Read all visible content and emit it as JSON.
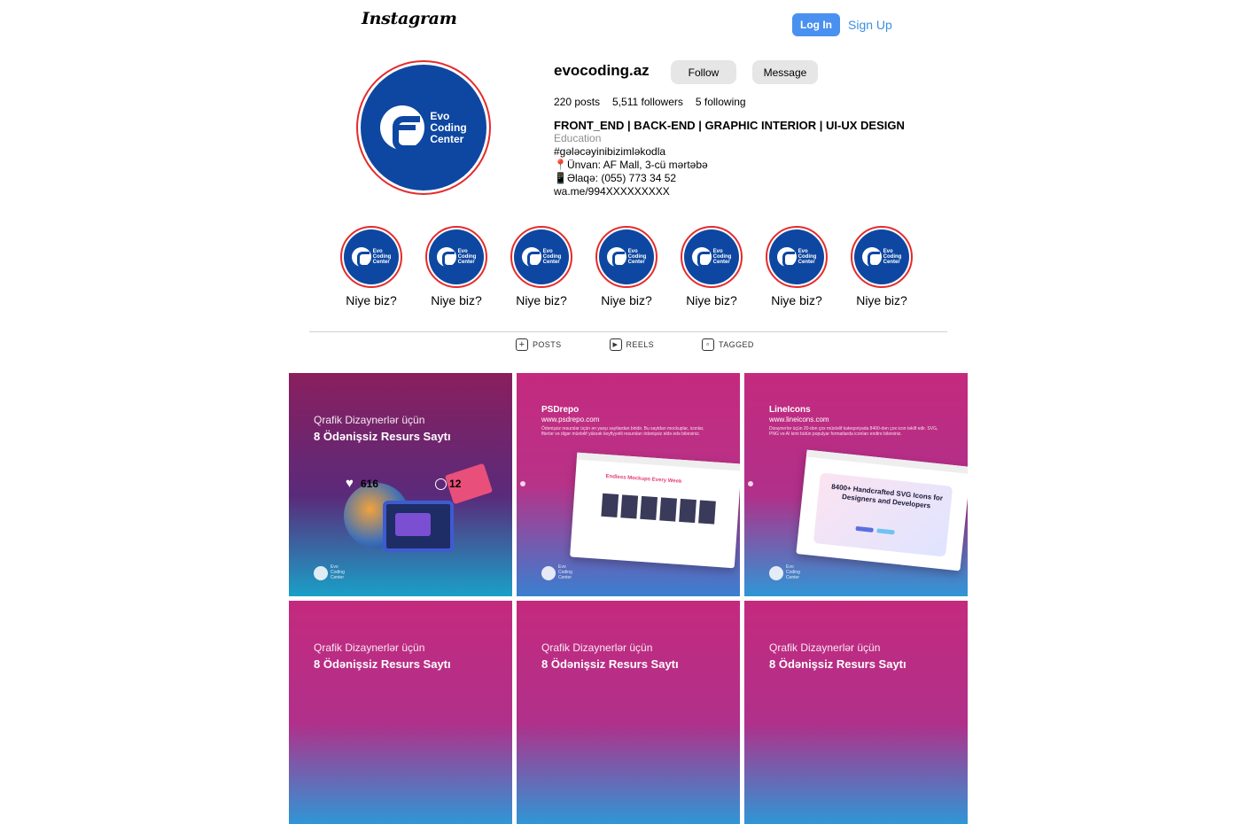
{
  "header": {
    "logo": "Instagram",
    "login_label": "Log In",
    "signup_label": "Sign Up"
  },
  "profile": {
    "username": "evocoding.az",
    "follow_label": "Follow",
    "message_label": "Message",
    "avatar_text": "Evo\nCoding\nCenter",
    "stats": {
      "posts": "220 posts",
      "followers": "5,511 followers",
      "following": "5 following"
    },
    "bio": {
      "name": "FRONT_END | BACK-END | GRAPHIC INTERIOR | UI-UX DESIGN",
      "category": "Education",
      "line1": "#gələcəyinibizimləkodla",
      "line2": "📍Ünvan: AF Mall, 3-cü mərtəbə",
      "line3": "📱Əlaqə: (055) 773 34 52",
      "line4": "wa.me/994XXXXXXXXX"
    }
  },
  "highlights": [
    {
      "label": "Niye biz?"
    },
    {
      "label": "Niye biz?"
    },
    {
      "label": "Niye biz?"
    },
    {
      "label": "Niye biz?"
    },
    {
      "label": "Niye biz?"
    },
    {
      "label": "Niye biz?"
    },
    {
      "label": "Niye biz?"
    }
  ],
  "highlight_brand": "Evo\nCoding\nCenter",
  "tabs": [
    {
      "label": "POSTS",
      "icon": "grid-icon"
    },
    {
      "label": "REELS",
      "icon": "reels-icon"
    },
    {
      "label": "TAGGED",
      "icon": "tagged-icon"
    }
  ],
  "posts": [
    {
      "title_line1": "Qrafik Dizaynerlər üçün",
      "title_line2": "8 Ödənişsiz Resurs Saytı",
      "likes": "616",
      "comments": "12",
      "logo_text": "Evo Coding Center"
    },
    {
      "name": "PSDrepo",
      "url": "www.psdrepo.com",
      "desc": "Ödənişsiz resurslar üçün ən yaxşı saytlardan biridir. Bu saytdan mockuplar, iconlar, flterlər və digər müxtəlif yüksək keyfiyyətli resursları ödənişsiz əldə edə bilərsiniz.",
      "mock_head": "Endless Mockups Every Week",
      "logo_text": "Evo Coding Center"
    },
    {
      "name": "LineIcons",
      "url": "www.lineicons.com",
      "desc": "Dizaynerlər üçün 20-dən çox müxtəlif kateqoriyada 8400-dən çox icon təklif edir. SVG, PNG və AI kimi bütün populyar formatlarda iconları endirə bilərsiniz.",
      "mock_text": "8400+ Handcrafted SVG Icons for Designers and Developers",
      "logo_text": "Evo Coding Center"
    },
    {
      "title_line1": "Qrafik Dizaynerlər üçün",
      "title_line2": "8 Ödənişsiz Resurs Saytı"
    },
    {
      "title_line1": "Qrafik Dizaynerlər üçün",
      "title_line2": "8 Ödənişsiz Resurs Saytı"
    },
    {
      "title_line1": "Qrafik Dizaynerlər üçün",
      "title_line2": "8 Ödənişsiz Resurs Saytı"
    }
  ],
  "colors": {
    "brand_blue": "#0d47a1",
    "ring_red": "#e52b2b",
    "login_blue": "#4a90f0",
    "link_blue": "#3b8fe0"
  }
}
